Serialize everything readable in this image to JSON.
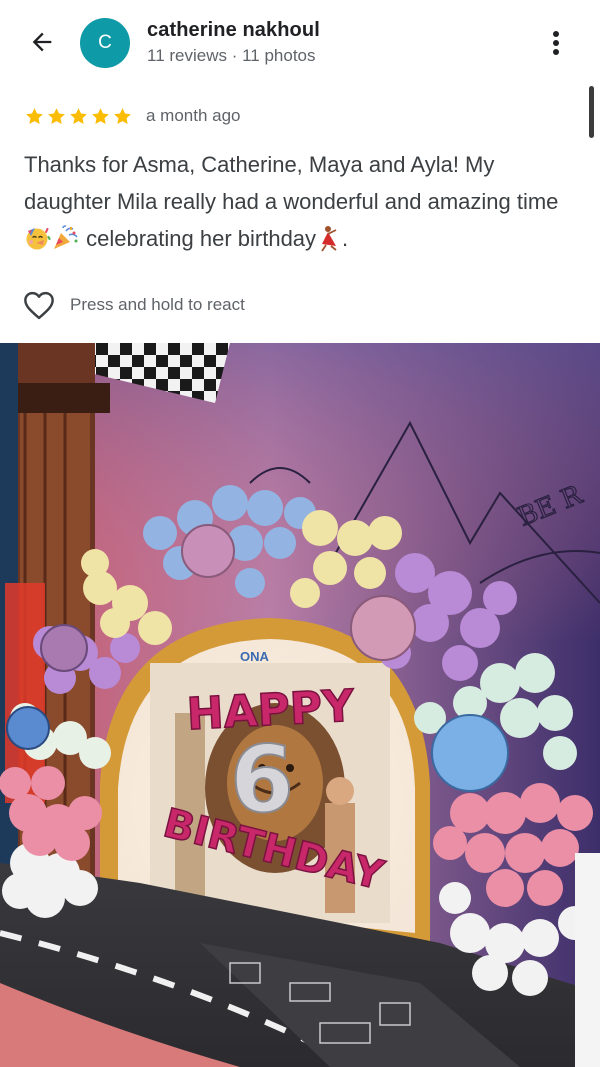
{
  "header": {
    "avatar_letter": "C",
    "user_name": "catherine nakhoul",
    "user_meta": "11 reviews · 11 photos",
    "avatar_color": "#0e9aa7"
  },
  "review": {
    "stars": 5,
    "star_color": "#fbbc04",
    "time_ago": "a month ago",
    "text_line1": "Thanks for Asma, Catherine, Maya and Ayla! My daughter Mila really had a wonderful and amazing time",
    "emojis": [
      "partying-face",
      "party-popper"
    ],
    "text_line2": "celebrating her birthday",
    "emoji_end": "dancer",
    "text_end": "."
  },
  "react": {
    "label": "Press and hold to react",
    "icon": "heart-outline-icon"
  },
  "photo": {
    "banner_word1": "HAPPY",
    "banner_number": "6",
    "banner_word2": "BIRTHDAY",
    "wall_text": "BE R",
    "poster_tag": "ONA"
  }
}
